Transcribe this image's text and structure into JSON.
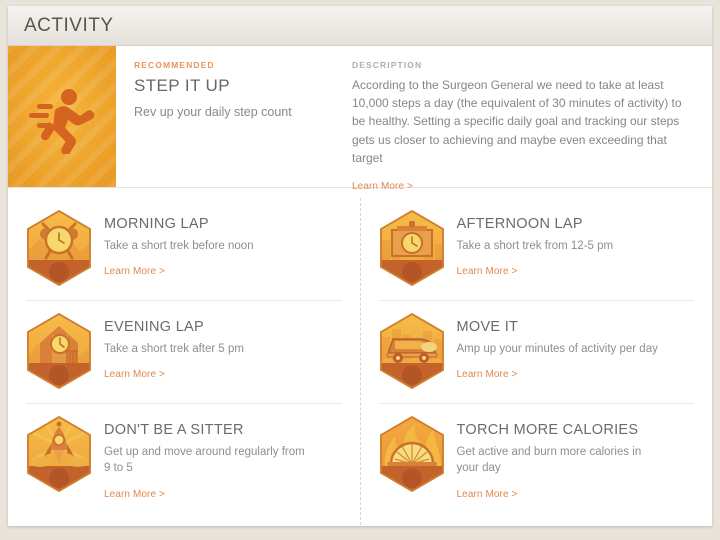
{
  "header": {
    "title": "ACTIVITY"
  },
  "hero": {
    "tile_icon": "running-person-icon",
    "eyebrow": "RECOMMENDED",
    "title": "STEP IT UP",
    "subtitle": "Rev up your daily step count",
    "description_label": "DESCRIPTION",
    "description": "According to the Surgeon General we need to take at least 10,000 steps a day (the equivalent of 30 minutes of activity) to be healthy. Setting a specific daily goal and tracking our steps gets us closer to achieving and maybe even exceeding that target",
    "learn_more": "Learn More >"
  },
  "colors": {
    "accent_orange": "#e1884f",
    "tile_gold": "#f0a42a",
    "badge_top": "#f3b63f",
    "badge_bottom": "#c4622c",
    "header_text": "#58544f"
  },
  "cards": {
    "left": [
      {
        "icon": "alarm-clock-icon",
        "title": "MORNING LAP",
        "subtitle": "Take a short trek before noon",
        "learn_more": "Learn More >"
      },
      {
        "icon": "clock-house-icon",
        "title": "EVENING LAP",
        "subtitle": "Take a short trek after 5 pm",
        "learn_more": "Learn More >"
      },
      {
        "icon": "rocket-icon",
        "title": "DON'T BE A SITTER",
        "subtitle": "Get up and move around regularly from 9 to 5",
        "learn_more": "Learn More >"
      }
    ],
    "right": [
      {
        "icon": "pocket-watch-icon",
        "title": "AFTERNOON LAP",
        "subtitle": "Take a short trek from 12-5 pm",
        "learn_more": "Learn More >"
      },
      {
        "icon": "roller-skate-icon",
        "title": "MOVE IT",
        "subtitle": "Amp up your minutes of activity per day",
        "learn_more": "Learn More >"
      },
      {
        "icon": "flame-gauge-icon",
        "title": "TORCH MORE CALORIES",
        "subtitle": "Get active and burn more calories in your day",
        "learn_more": "Learn More >"
      }
    ]
  }
}
